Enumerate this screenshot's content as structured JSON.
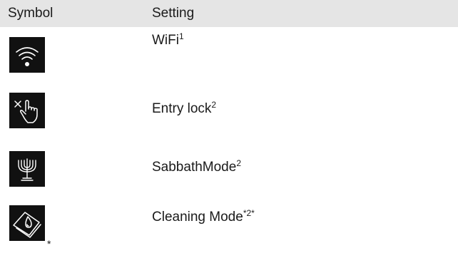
{
  "table": {
    "header": {
      "symbol": "Symbol",
      "setting": "Setting"
    },
    "rows": [
      {
        "icon": "wifi-icon",
        "label": "WiFi",
        "sup": "1"
      },
      {
        "icon": "entry-lock-icon",
        "label": "Entry lock",
        "sup": "2"
      },
      {
        "icon": "sabbath-menorah-icon",
        "label": "SabbathMode",
        "sup": "2"
      },
      {
        "icon": "cleaning-mode-icon",
        "label": "Cleaning Mode",
        "sup": "*2*",
        "icon_note": "*"
      }
    ]
  },
  "colors": {
    "header_bg": "#e5e5e5",
    "icon_bg": "#111111",
    "icon_fg": "#ffffff",
    "text": "#1a1a1a"
  }
}
